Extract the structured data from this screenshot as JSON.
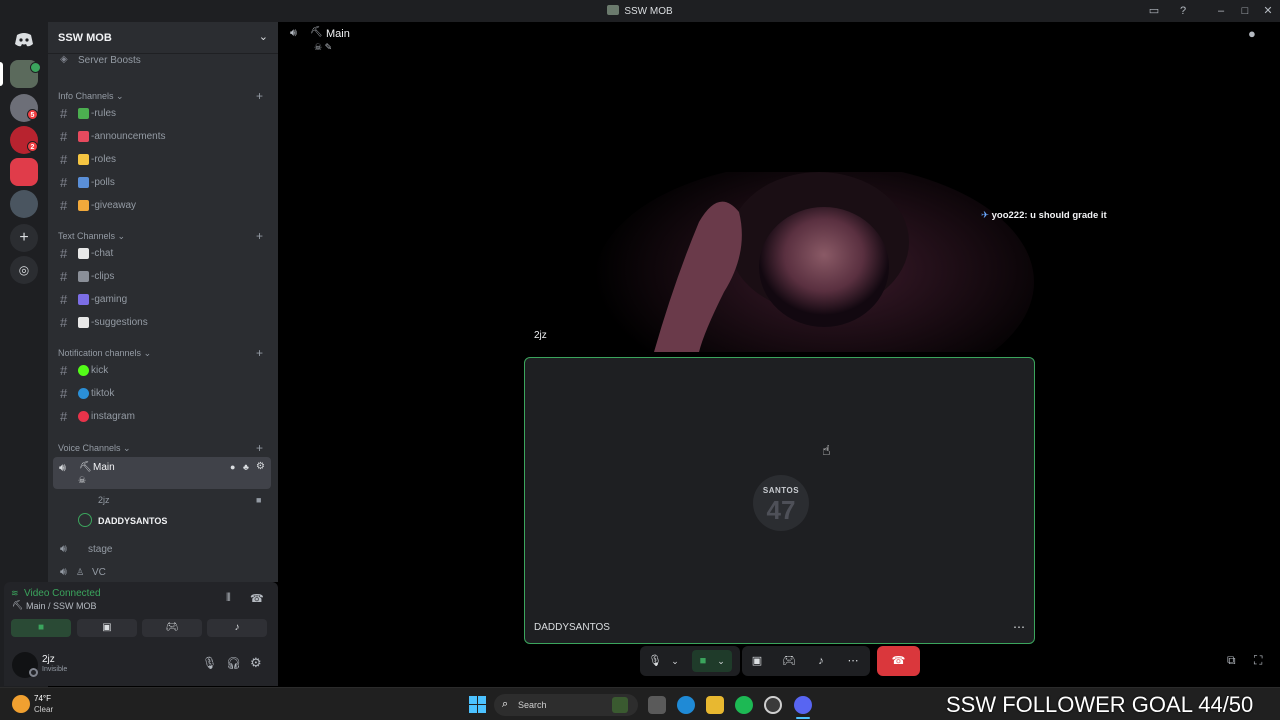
{
  "window": {
    "title": "SSW MOB"
  },
  "server": {
    "name": "SSW MOB",
    "boosts_label": "Server Boosts"
  },
  "categories": {
    "info": "Info Channels",
    "text": "Text Channels",
    "notification": "Notification channels",
    "voice": "Voice Channels"
  },
  "info_channels": [
    {
      "label": "-rules",
      "color": "#4caf50"
    },
    {
      "label": "-announcements",
      "color": "#e64a5e"
    },
    {
      "label": "-roles",
      "color": "#f5c542"
    },
    {
      "label": "-polls",
      "color": "#5a8fd8"
    },
    {
      "label": "-giveaway",
      "color": "#f2a93b"
    }
  ],
  "text_channels": [
    {
      "label": "-chat",
      "color": "#e8e8e8"
    },
    {
      "label": "-clips",
      "color": "#8a8f98"
    },
    {
      "label": "-gaming",
      "color": "#7c6ee6"
    },
    {
      "label": "-suggestions",
      "color": "#e8e8e8"
    }
  ],
  "notification_channels": [
    {
      "label": "kick",
      "color": "#53fc18"
    },
    {
      "label": "tiktok",
      "color": "#2b8fd6"
    },
    {
      "label": "instagram",
      "color": "#e8334a"
    }
  ],
  "voice": {
    "main_label": "Main",
    "members": [
      "2jz",
      "DADDYSANTOS"
    ],
    "stage_label": "stage",
    "vc_label": "VC"
  },
  "voice_panel": {
    "status": "Video Connected",
    "location": "Main / SSW MOB"
  },
  "user": {
    "name": "2jz",
    "status": "Invisible"
  },
  "main": {
    "header_title": "Main",
    "stream_name": "2jz",
    "chat_author": "yoo222:",
    "chat_text": "u should grade it",
    "cam_name": "DADDYSANTOS",
    "avatar_text_top": "SANTOS",
    "avatar_text_num": "47"
  },
  "taskbar": {
    "weather_temp": "74°F",
    "weather_desc": "Clear",
    "search_placeholder": "Search",
    "ticker": "SSW FOLLOWER GOAL 44/50"
  },
  "colors": {
    "accent_green": "#3ba55d",
    "hangup_red": "#da373c",
    "rail_bg": "#1e1f22",
    "sidebar_bg": "#2b2d31"
  }
}
